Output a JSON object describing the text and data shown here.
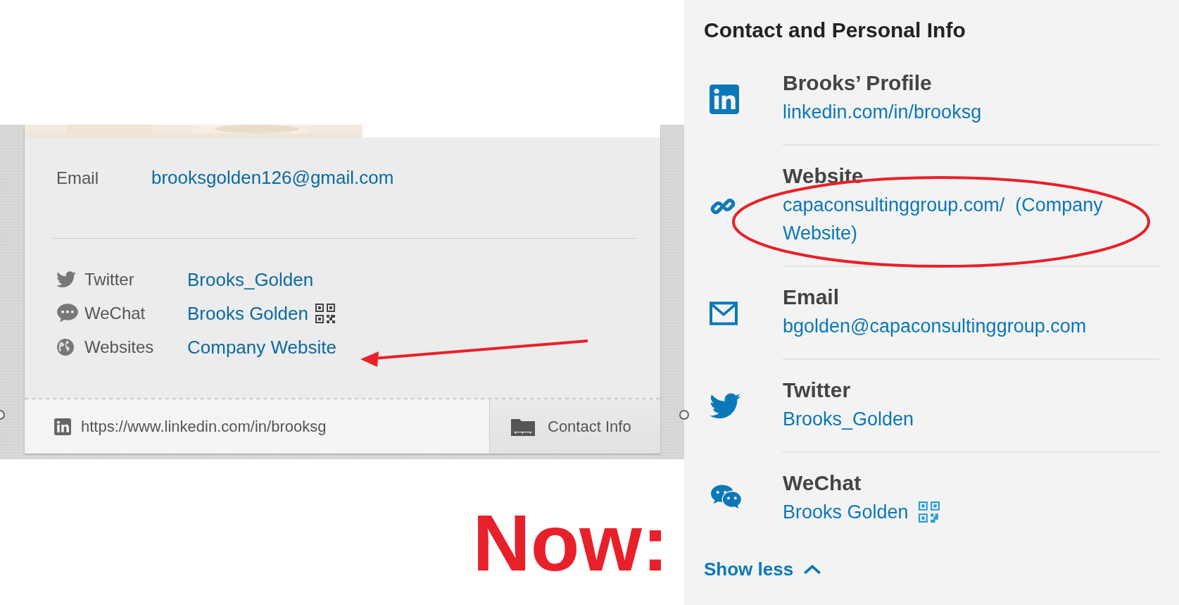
{
  "old_card": {
    "email": {
      "label": "Email",
      "value": "brooksgolden126@gmail.com"
    },
    "accounts": [
      {
        "kind": "twitter",
        "label": "Twitter",
        "value": "Brooks_Golden",
        "qr": false
      },
      {
        "kind": "wechat",
        "label": "WeChat",
        "value": "Brooks Golden",
        "qr": true
      },
      {
        "kind": "website",
        "label": "Websites",
        "value": "Company Website",
        "qr": false
      }
    ],
    "footer": {
      "url": "https://www.linkedin.com/in/brooksg",
      "button": "Contact Info"
    }
  },
  "caption": "Now:",
  "panel": {
    "title": "Contact and Personal Info",
    "items": [
      {
        "kind": "linkedin",
        "title": "Brooks’ Profile",
        "value": "linkedin.com/in/brooksg",
        "qr": false
      },
      {
        "kind": "website",
        "title": "Website",
        "value": "capaconsultinggroup.com/  (Company Website)",
        "qr": false
      },
      {
        "kind": "email",
        "title": "Email",
        "value": "bgolden@capaconsultinggroup.com",
        "qr": false
      },
      {
        "kind": "twitter",
        "title": "Twitter",
        "value": "Brooks_Golden",
        "qr": false
      },
      {
        "kind": "wechat",
        "title": "WeChat",
        "value": "Brooks Golden",
        "qr": true
      }
    ],
    "toggle": "Show less"
  }
}
